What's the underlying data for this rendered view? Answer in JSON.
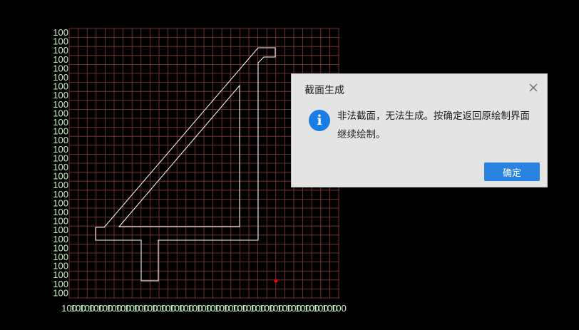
{
  "canvas": {
    "background": "#000000",
    "grid_color": "#8b3a3a",
    "axis_label_color": "#c8f7c5",
    "axis_tick_label": "100",
    "shape_color": "#ffffff",
    "marker_color": "#ff0000"
  },
  "dialog": {
    "title": "截面生成",
    "message": "非法截面，无法生成。按确定返回原绘制界面继续绘制。",
    "ok_label": "确定",
    "info_icon": "i",
    "icon": "info-icon",
    "accent": "#2a83e0"
  }
}
